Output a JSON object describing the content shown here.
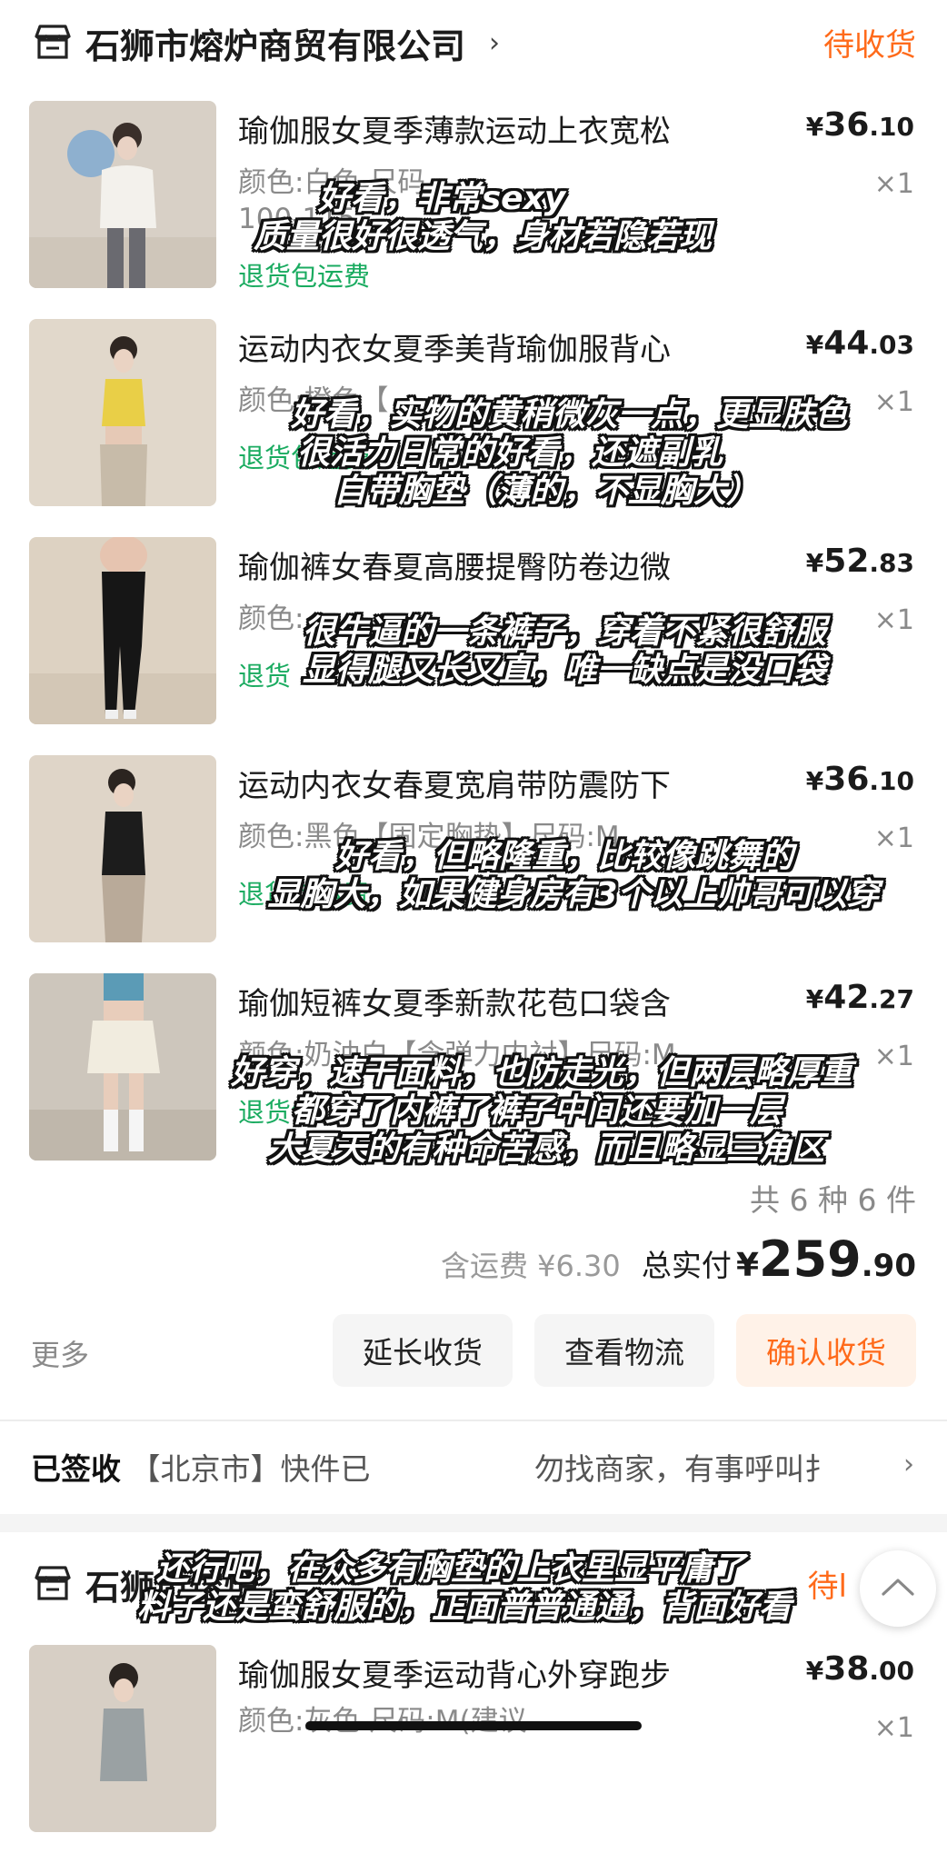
{
  "shops": [
    {
      "name": "石狮市熔炉商贸有限公司",
      "status": "待收货"
    },
    {
      "name": "石狮市熔炉",
      "status": "待l"
    }
  ],
  "items": [
    {
      "title": "瑜伽服女夏季薄款运动上衣宽松",
      "price_yen": "¥",
      "price_int": "36",
      "price_dec": ".10",
      "spec_line1": "颜色:白色 尺码",
      "spec_line2": "100-115",
      "qty": "×1",
      "return_text": "退货包运费"
    },
    {
      "title": "运动内衣女夏季美背瑜伽服背心",
      "price_yen": "¥",
      "price_int": "44",
      "price_dec": ".03",
      "spec_line1": "颜色:橙色【",
      "spec_line2": "",
      "qty": "×1",
      "return_text": "退货包运费"
    },
    {
      "title": "瑜伽裤女春夏高腰提臀防卷边微",
      "price_yen": "¥",
      "price_int": "52",
      "price_dec": ".83",
      "spec_line1": "颜色:",
      "spec_line2": "",
      "qty": "×1",
      "return_text": "退货"
    },
    {
      "title": "运动内衣女春夏宽肩带防震防下",
      "price_yen": "¥",
      "price_int": "36",
      "price_dec": ".10",
      "spec_line1": "颜色:黑色【固定胸垫】尺码:M",
      "spec_line2": "",
      "qty": "×1",
      "return_text": "退货包运费"
    },
    {
      "title": "瑜伽短裤女夏季新款花苞口袋含",
      "price_yen": "¥",
      "price_int": "42",
      "price_dec": ".27",
      "spec_line1": "颜色:奶油白【含弹力内衬】尺码:M",
      "spec_line2": "",
      "qty": "×1",
      "return_text": "退货包"
    },
    {
      "title": "瑜伽服女夏季运动背心外穿跑步",
      "price_yen": "¥",
      "price_int": "38",
      "price_dec": ".00",
      "spec_line1": "颜色:灰色 尺码:M(建议",
      "spec_line2": "",
      "qty": "×1",
      "return_text": ""
    }
  ],
  "captions": [
    [
      "好看，非常sexy",
      "质量很好很透气，身材若隐若现"
    ],
    [
      "好看，实物的黄稍微灰一点，更显肤色",
      "很活力日常的好看，还遮副乳",
      "自带胸垫（薄的，不显胸大）"
    ],
    [
      "很牛逼的一条裤子，穿着不紧很舒服",
      "显得腿又长又直，唯一缺点是没口袋"
    ],
    [
      "好看，但略隆重，比较像跳舞的",
      "显胸大，如果健身房有3个以上帅哥可以穿"
    ],
    [
      "好穿，速干面料，也防走光，但两层略厚重",
      "都穿了内裤了裤子中间还要加一层",
      "大夏天的有种命苦感，而且略显三角区"
    ],
    [
      "还行吧，在众多有胸垫的上衣里显平庸了",
      "料子还是蛮舒服的，正面普普通通，背面好看"
    ]
  ],
  "summary": {
    "count": "共 6 种 6 件",
    "shipping": "含运费 ¥6.30",
    "total_label": "总实付",
    "total_yen": "¥",
    "total_int": "259",
    "total_dec": ".90"
  },
  "actions": {
    "more": "更多",
    "extend": "延长收货",
    "logistics": "查看物流",
    "confirm": "确认收货"
  },
  "tracking": {
    "signed": "已签收",
    "text": "【北京市】快件已",
    "text2": "勿找商家，有事呼叫扌"
  },
  "colors": {
    "accent": "#ff6a1a",
    "green": "#1aab60",
    "muted": "#8a8a8a"
  }
}
